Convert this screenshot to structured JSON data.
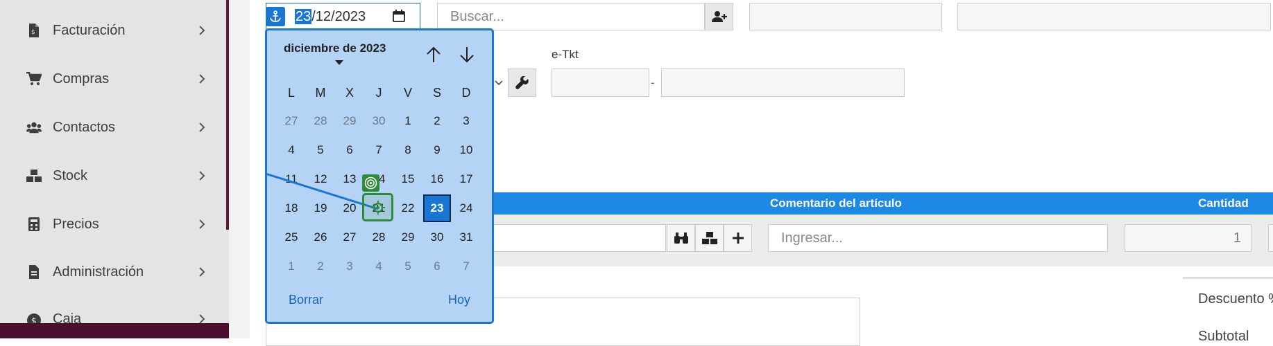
{
  "sidebar": {
    "items": [
      {
        "label": "Facturación",
        "icon": "invoice-icon"
      },
      {
        "label": "Compras",
        "icon": "cart-icon"
      },
      {
        "label": "Contactos",
        "icon": "users-icon"
      },
      {
        "label": "Stock",
        "icon": "boxes-icon"
      },
      {
        "label": "Precios",
        "icon": "calculator-icon"
      },
      {
        "label": "Administración",
        "icon": "document-icon"
      },
      {
        "label": "Caja",
        "icon": "cash-icon"
      }
    ]
  },
  "header": {
    "date_value_day": "23",
    "date_value_rest": "/12/2023",
    "search_placeholder": "Buscar..."
  },
  "etkt": {
    "label": "e-Tkt",
    "separator": "-"
  },
  "items": {
    "comment_header": "Comentario del artículo",
    "qty_header": "Cantidad",
    "comment_placeholder": "Ingresar...",
    "qty_value": "1"
  },
  "totals": {
    "discount_label": "Descuento %",
    "subtotal_label": "Subtotal"
  },
  "datepicker": {
    "month_label": "diciembre de 2023",
    "weekdays": [
      "L",
      "M",
      "X",
      "J",
      "V",
      "S",
      "D"
    ],
    "weeks": [
      [
        "27",
        "28",
        "29",
        "30",
        "1",
        "2",
        "3"
      ],
      [
        "4",
        "5",
        "6",
        "7",
        "8",
        "9",
        "10"
      ],
      [
        "11",
        "12",
        "13",
        "14",
        "15",
        "16",
        "17"
      ],
      [
        "18",
        "19",
        "20",
        "21",
        "22",
        "23",
        "24"
      ],
      [
        "25",
        "26",
        "27",
        "28",
        "29",
        "30",
        "31"
      ],
      [
        "1",
        "2",
        "3",
        "4",
        "5",
        "6",
        "7"
      ]
    ],
    "selected_day": "23",
    "clear_label": "Borrar",
    "today_label": "Hoy"
  },
  "colors": {
    "accent": "#1976d2",
    "marker": "#2e8b3a",
    "sidebar_dark": "#4a0f2e"
  }
}
